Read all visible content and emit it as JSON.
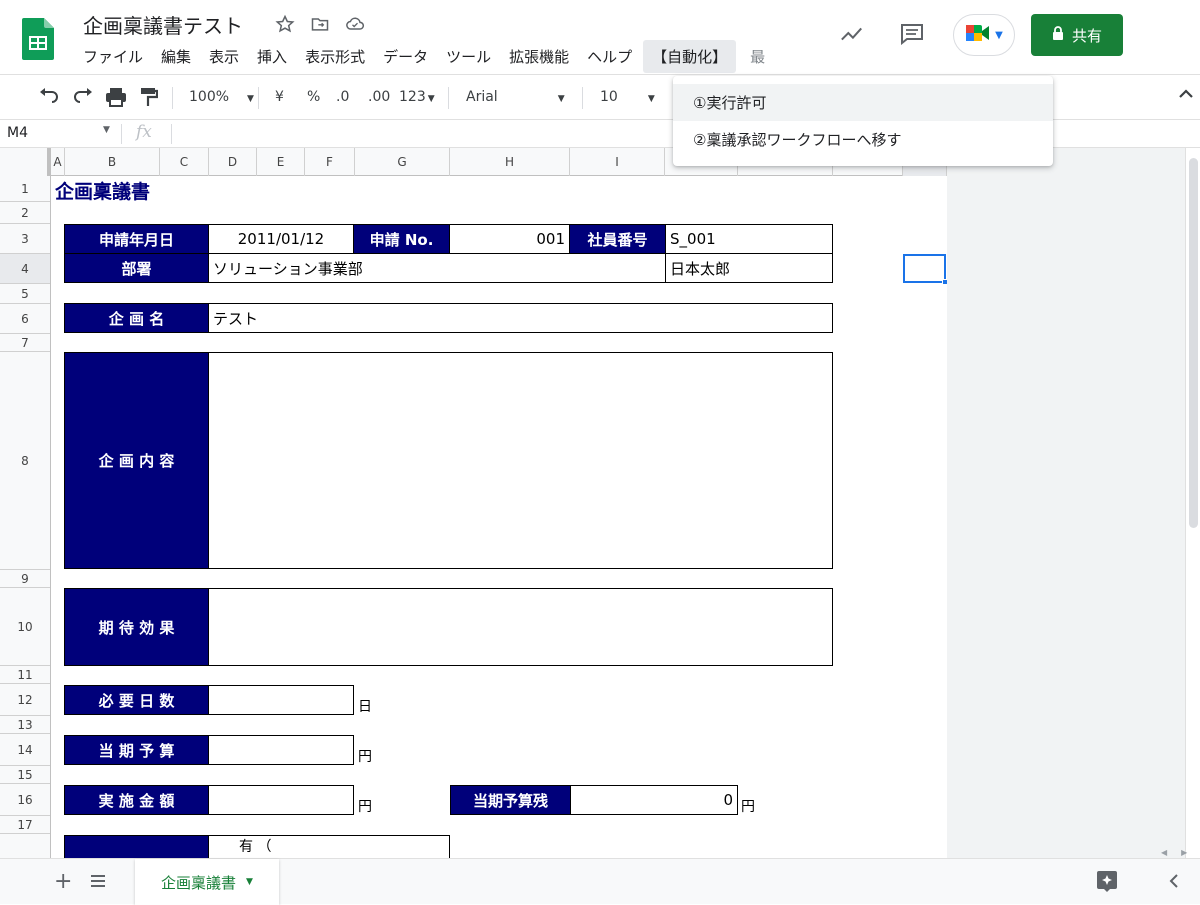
{
  "doc": {
    "title": "企画稟議書テスト"
  },
  "menu": [
    "ファイル",
    "編集",
    "表示",
    "挿入",
    "表示形式",
    "データ",
    "ツール",
    "拡張機能",
    "ヘルプ",
    "【自動化】",
    "最"
  ],
  "share": {
    "label": "共有"
  },
  "toolbar": {
    "zoom": "100%",
    "currency": "¥",
    "percent": "%",
    "dec_decrease": ".0",
    "dec_increase": ".00",
    "format_more": "123",
    "font": "Arial",
    "font_size": "10"
  },
  "formula": {
    "cell_ref": "M4",
    "fx": "fx"
  },
  "columns": [
    "A",
    "B",
    "C",
    "D",
    "E",
    "F",
    "G",
    "H",
    "I"
  ],
  "rows": [
    "1",
    "2",
    "3",
    "4",
    "5",
    "6",
    "7",
    "8",
    "9",
    "10",
    "11",
    "12",
    "13",
    "14",
    "15",
    "16",
    "17"
  ],
  "form": {
    "title": "企画稟議書",
    "apply_date_label": "申請年月日",
    "apply_date": "2011/01/12",
    "apply_no_label": "申請 No.",
    "apply_no": "001",
    "employee_no_label": "社員番号",
    "employee_no": "S_001",
    "department_label": "部署",
    "department": "ソリューション事業部",
    "name": "日本太郎",
    "plan_name_label": "企 画 名",
    "plan_name": "テスト",
    "plan_content_label": "企 画 内 容",
    "expected_effect_label": "期 待 効 果",
    "required_days_label": "必 要 日 数",
    "days_unit": "日",
    "current_budget_label": "当 期 予 算",
    "yen_unit_1": "円",
    "implementation_amount_label": "実 施 金 額",
    "yen_unit_2": "円",
    "remaining_budget_label": "当期予算残",
    "remaining_budget": "0",
    "yen_unit_3": "円",
    "partial_row18": "有 （"
  },
  "dropdown": {
    "items": [
      "①実行許可",
      "②稟議承認ワークフローへ移す"
    ]
  },
  "sheet_tab": {
    "label": "企画稟議書"
  }
}
